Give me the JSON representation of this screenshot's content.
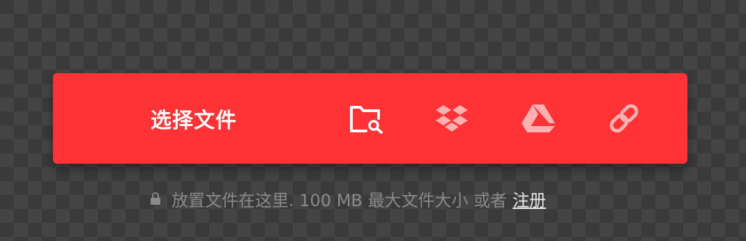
{
  "colors": {
    "accent": "#ff3236",
    "icon_white": "#ffffff",
    "icon_faded": "#ffb0b0",
    "hint_text": "#8a8a8a"
  },
  "upload": {
    "choose_file_label": "选择文件",
    "sources": [
      {
        "name": "device-folder-search",
        "icon": "folder-search-icon"
      },
      {
        "name": "dropbox",
        "icon": "dropbox-icon"
      },
      {
        "name": "google-drive",
        "icon": "google-drive-icon"
      },
      {
        "name": "url-link",
        "icon": "link-icon"
      }
    ]
  },
  "hint": {
    "text": "放置文件在这里. 100 MB 最大文件大小 或者",
    "signup_label": "注册"
  }
}
